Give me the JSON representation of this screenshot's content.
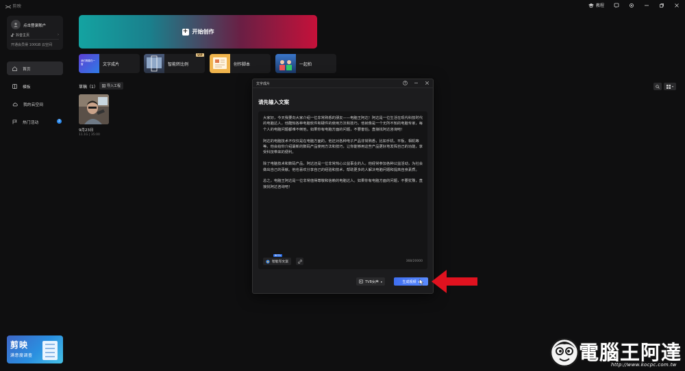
{
  "titlebar": {
    "app_name": "剪映",
    "tutorial_label": "教程"
  },
  "sidebar": {
    "user": {
      "login_label": "点击登录账户",
      "tiktok_label": "抖音主页",
      "storage_label": "开通会员得 100GB 云空间"
    },
    "nav": [
      {
        "label": "首页",
        "icon": "home-icon"
      },
      {
        "label": "模板",
        "icon": "template-icon"
      },
      {
        "label": "我的云空间",
        "icon": "cloud-icon"
      },
      {
        "label": "热门活动",
        "icon": "flag-icon",
        "badge": "2"
      }
    ],
    "promo": {
      "title": "剪映",
      "subtitle": "满意度调查"
    }
  },
  "main": {
    "start_label": "开始创作",
    "features": [
      {
        "label": "文字成片",
        "thumb_text": "我们需要在一窗"
      },
      {
        "label": "智能转比例",
        "badge": "VIP"
      },
      {
        "label": "创作脚本"
      },
      {
        "label": "一起拍"
      }
    ],
    "drafts": {
      "title": "草稿（1）",
      "import_label": "导入工程",
      "items": [
        {
          "date": "9月23日",
          "meta": "11.1G | 35:00"
        }
      ]
    }
  },
  "dialog": {
    "header": "文字成片",
    "title": "请先输入文案",
    "paragraphs": [
      "大家好，今天我要向大家介绍一位非常熟悉的朋友——电脑王阿达！阿达是一位生活在现代科技时代的电脑达人，他酷知各种电脑软件和硬件的使用方法和技巧。他就像是一个无所不知的电脑专家，每个人的电脑问题都难不倒他。如果你有电脑方面的问题，不要害怕，直接找阿达咨询吧！",
      "阿达的电脑技术不仅仅是在电脑方面的，他还对各种电子产品非常熟悉，比如手机、平板、相机等等。他会给你介绍最新的数码产品使用方法和技巧，让你能够用这些产品更好地发挥自己的功能，享受科技带来的便利。",
      "除了电脑技术和数码产品，阿达还是一位非常热心公益事业的人。他经常参加各种公益活动，为社会做出自己的贡献。他也喜欢分享自己的经验和技术，帮助更多的人解决电脑问题和提高自身素质。",
      "总之，电脑王阿达是一位非常值得尊敬和信赖的电脑达人。如果你有电脑方面的问题，不要犹豫，直接找阿达咨询吧！"
    ],
    "smart_label": "智能写文案",
    "beta_label": "BETA",
    "counter": "368/20000",
    "voice_label": "TVB女声",
    "generate_label": "生成视频"
  },
  "watermark": {
    "title": "電腦王阿達",
    "url": "http://www.kocpc.com.tw"
  }
}
